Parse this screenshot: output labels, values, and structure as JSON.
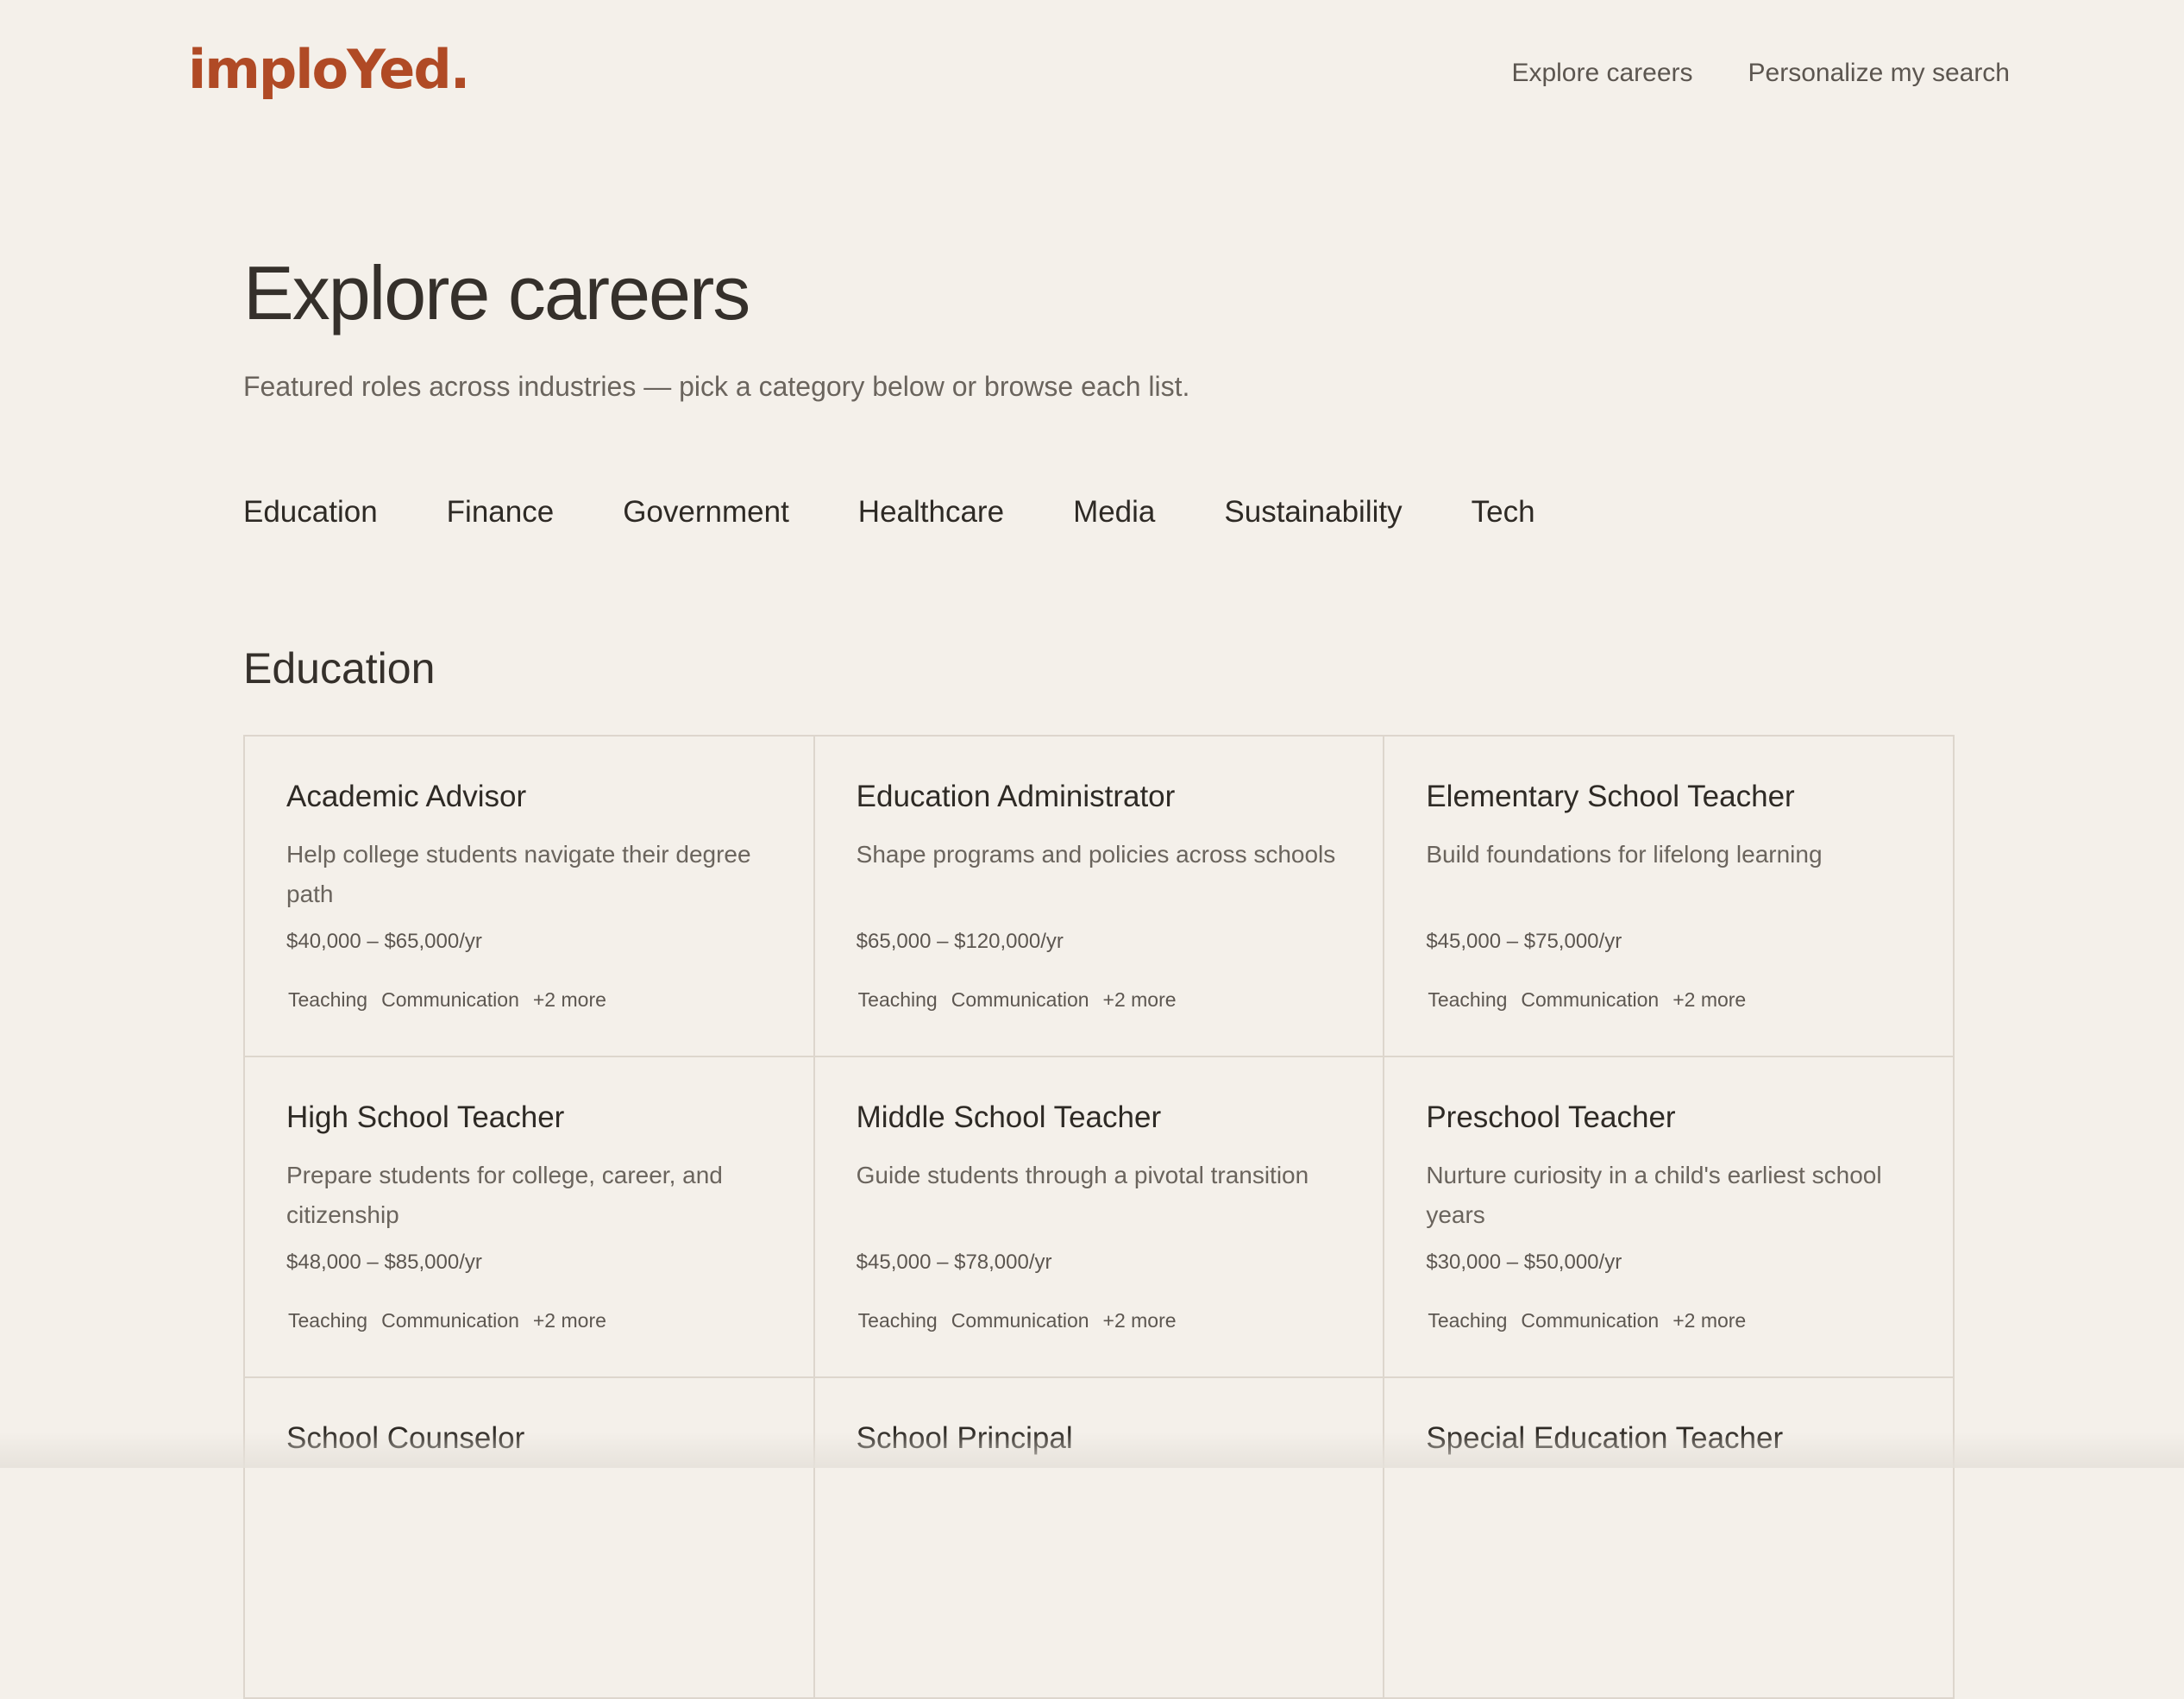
{
  "header": {
    "logo_text": "imploYed.",
    "nav": [
      {
        "label": "Explore careers"
      },
      {
        "label": "Personalize my search"
      }
    ]
  },
  "hero": {
    "title": "Explore careers",
    "subtitle": "Featured roles across industries — pick a category below or browse each list."
  },
  "tabs": [
    {
      "label": "Education"
    },
    {
      "label": "Finance"
    },
    {
      "label": "Government"
    },
    {
      "label": "Healthcare"
    },
    {
      "label": "Media"
    },
    {
      "label": "Sustainability"
    },
    {
      "label": "Tech"
    }
  ],
  "section": {
    "title": "Education",
    "cards": [
      {
        "title": "Academic Advisor",
        "desc": "Help college students navigate their degree path",
        "salary": "$40,000 – $65,000/yr",
        "tags": [
          "Teaching",
          "Communication",
          "+2 more"
        ]
      },
      {
        "title": "Education Administrator",
        "desc": "Shape programs and policies across schools",
        "salary": "$65,000 – $120,000/yr",
        "tags": [
          "Teaching",
          "Communication",
          "+2 more"
        ]
      },
      {
        "title": "Elementary School Teacher",
        "desc": "Build foundations for lifelong learning",
        "salary": "$45,000 – $75,000/yr",
        "tags": [
          "Teaching",
          "Communication",
          "+2 more"
        ]
      },
      {
        "title": "High School Teacher",
        "desc": "Prepare students for college, career, and citizenship",
        "salary": "$48,000 – $85,000/yr",
        "tags": [
          "Teaching",
          "Communication",
          "+2 more"
        ]
      },
      {
        "title": "Middle School Teacher",
        "desc": "Guide students through a pivotal transition",
        "salary": "$45,000 – $78,000/yr",
        "tags": [
          "Teaching",
          "Communication",
          "+2 more"
        ]
      },
      {
        "title": "Preschool Teacher",
        "desc": "Nurture curiosity in a child's earliest school years",
        "salary": "$30,000 – $50,000/yr",
        "tags": [
          "Teaching",
          "Communication",
          "+2 more"
        ]
      },
      {
        "title": "School Counselor",
        "desc": "",
        "salary": "",
        "tags": []
      },
      {
        "title": "School Principal",
        "desc": "",
        "salary": "",
        "tags": []
      },
      {
        "title": "Special Education Teacher",
        "desc": "",
        "salary": "",
        "tags": []
      }
    ]
  },
  "colors": {
    "background": "#f4f0ea",
    "brand": "#b04a25",
    "text": "#2e2a25",
    "muted": "#6a645d",
    "border": "#ddd6cd"
  }
}
